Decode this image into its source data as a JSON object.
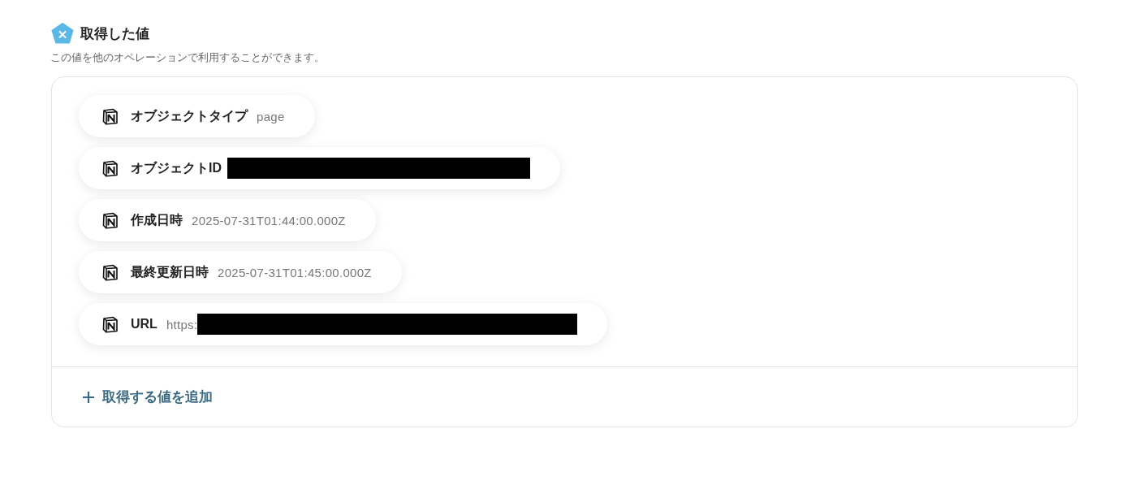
{
  "section": {
    "title": "取得した値",
    "description": "この値を他のオペレーションで利用することができます。"
  },
  "values": [
    {
      "label": "オブジェクトタイプ",
      "value": "page",
      "redacted": false
    },
    {
      "label": "オブジェクトID",
      "redacted": true
    },
    {
      "label": "作成日時",
      "value": "2025-07-31T01:44:00.000Z",
      "redacted": false
    },
    {
      "label": "最終更新日時",
      "value": "2025-07-31T01:45:00.000Z",
      "redacted": false
    },
    {
      "label": "URL",
      "value": "https:",
      "redacted": true
    }
  ],
  "add_button": {
    "label": "取得する値を追加"
  }
}
